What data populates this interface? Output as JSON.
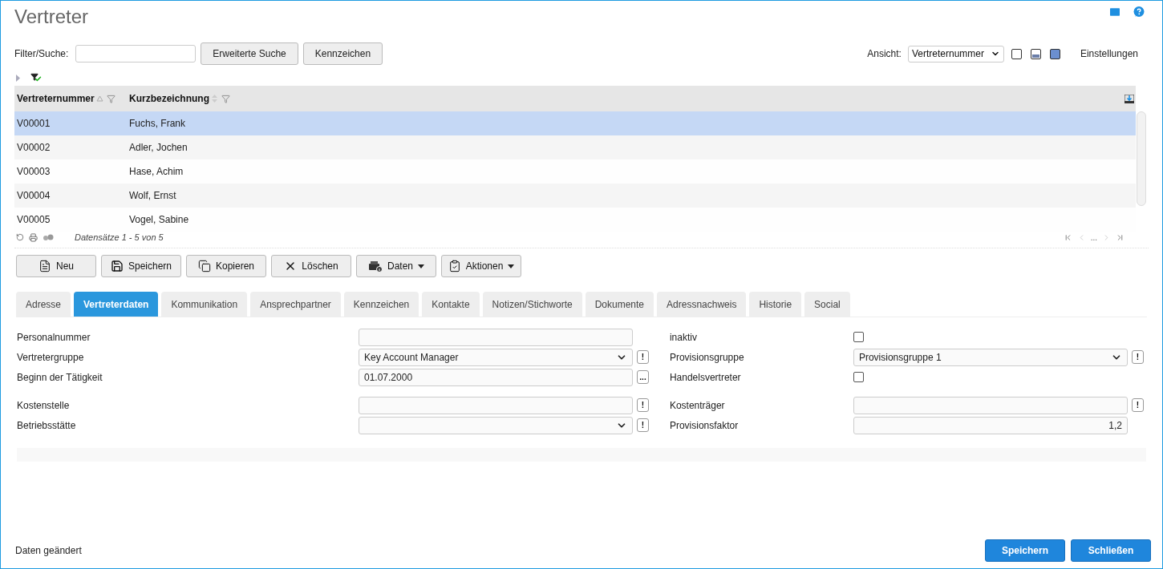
{
  "title": "Vertreter",
  "filter": {
    "label": "Filter/Suche:"
  },
  "filter_buttons": [
    "Erweiterte Suche",
    "Kennzeichen"
  ],
  "view": {
    "label": "Ansicht:",
    "value": "Vertreternummer"
  },
  "settings_link": "Einstellungen",
  "table": {
    "columns": [
      "Vertreternummer",
      "Kurzbezeichnung"
    ],
    "rows": [
      {
        "cells": [
          "V00001",
          "Fuchs, Frank"
        ],
        "selected": true
      },
      {
        "cells": [
          "V00002",
          "Adler, Jochen"
        ],
        "selected": false
      },
      {
        "cells": [
          "V00003",
          "Hase, Achim"
        ],
        "selected": false
      },
      {
        "cells": [
          "V00004",
          "Wolf, Ernst"
        ],
        "selected": false
      },
      {
        "cells": [
          "V00005",
          "Vogel, Sabine"
        ],
        "selected": false
      }
    ]
  },
  "record_count": "Datensätze 1 - 5 von 5",
  "pager_ellipsis": "...",
  "toolbar": [
    {
      "label": "Neu",
      "menu": false
    },
    {
      "label": "Speichern",
      "menu": false
    },
    {
      "label": "Kopieren",
      "menu": false
    },
    {
      "label": "Löschen",
      "menu": false
    },
    {
      "label": "Daten",
      "menu": true
    },
    {
      "label": "Aktionen",
      "menu": true
    }
  ],
  "tabs": [
    {
      "label": "Adresse",
      "selected": false
    },
    {
      "label": "Vertreterdaten",
      "selected": true
    },
    {
      "label": "Kommunikation",
      "selected": false
    },
    {
      "label": "Ansprechpartner",
      "selected": false
    },
    {
      "label": "Kennzeichen",
      "selected": false
    },
    {
      "label": "Kontakte",
      "selected": false
    },
    {
      "label": "Notizen/Stichworte",
      "selected": false
    },
    {
      "label": "Dokumente",
      "selected": false
    },
    {
      "label": "Adressnachweis",
      "selected": false
    },
    {
      "label": "Historie",
      "selected": false
    },
    {
      "label": "Social",
      "selected": false
    }
  ],
  "form": {
    "groups": [
      [
        {
          "left": {
            "label": "Personalnummer",
            "kind": "text"
          },
          "right": {
            "label": "inaktiv",
            "kind": "checkbox",
            "checked": false
          }
        },
        {
          "left": {
            "label": "Vertretergruppe",
            "kind": "select",
            "value": "Key Account Manager",
            "action": "!"
          },
          "right": {
            "label": "Provisionsgruppe",
            "kind": "select",
            "value": "Provisionsgruppe 1",
            "action": "!"
          }
        },
        {
          "left": {
            "label": "Beginn der Tätigkeit",
            "kind": "text",
            "value": "01.07.2000",
            "action": "..."
          },
          "right": {
            "label": "Handelsvertreter",
            "kind": "checkbox",
            "checked": false
          }
        }
      ],
      [
        {
          "left": {
            "label": "Kostenstelle",
            "kind": "text",
            "action": "!"
          },
          "right": {
            "label": "Kostenträger",
            "kind": "text",
            "action": "!"
          }
        },
        {
          "left": {
            "label": "Betriebsstätte",
            "kind": "select",
            "action": "!"
          },
          "right": {
            "label": "Provisionsfaktor",
            "kind": "number",
            "value": "1,2"
          }
        }
      ]
    ]
  },
  "status": "Daten geändert",
  "footer_buttons": [
    "Speichern",
    "Schließen"
  ]
}
